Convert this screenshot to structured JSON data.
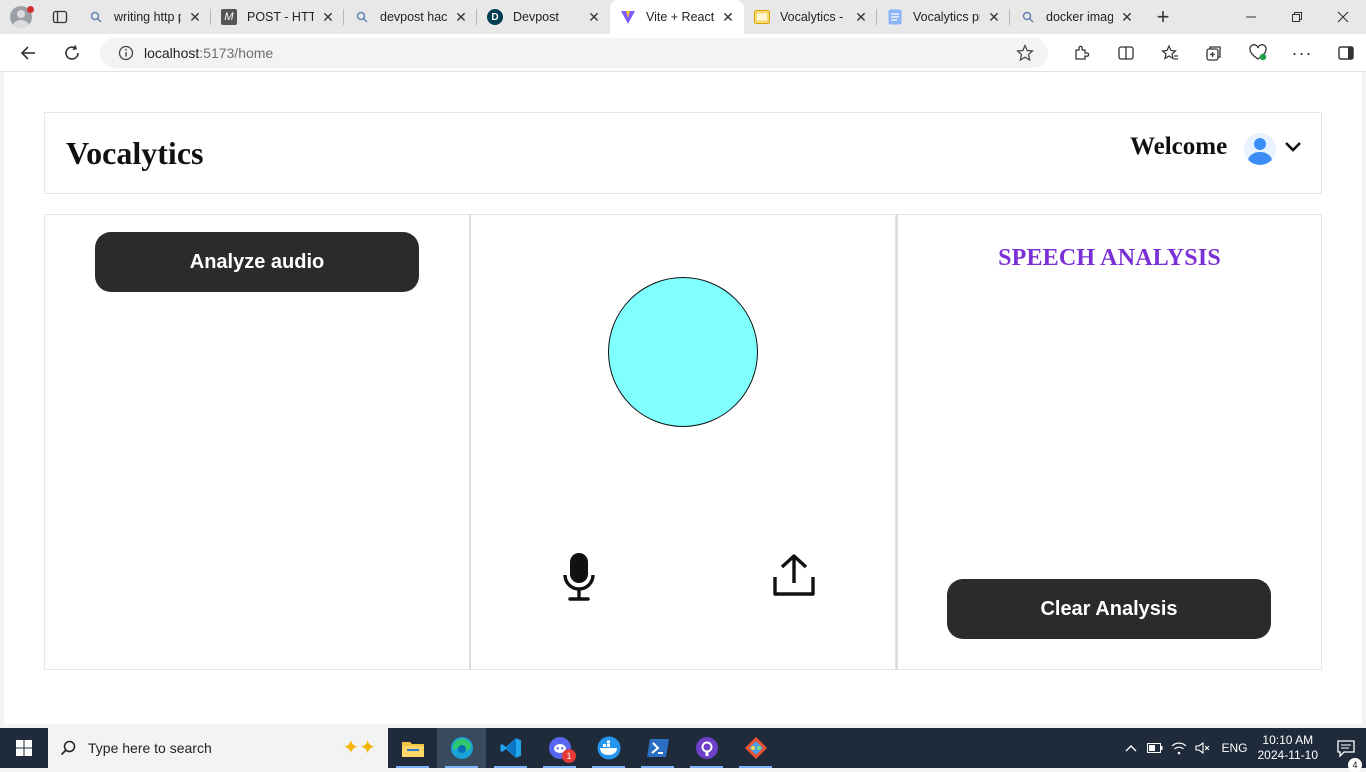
{
  "browser": {
    "tabs": [
      {
        "title": "writing http p",
        "icon": "search-icon"
      },
      {
        "title": "POST - HTTP",
        "icon": "mdn-icon"
      },
      {
        "title": "devpost hack",
        "icon": "search-icon"
      },
      {
        "title": "Devpost",
        "icon": "devpost-icon"
      },
      {
        "title": "Vite + React",
        "icon": "vite-icon",
        "active": true
      },
      {
        "title": "Vocalytics - H",
        "icon": "slides-icon"
      },
      {
        "title": "Vocalytics pre",
        "icon": "docs-icon"
      },
      {
        "title": "docker image",
        "icon": "search-icon"
      }
    ],
    "address": {
      "host": "localhost",
      "path": ":5173/home"
    }
  },
  "app": {
    "brand": "Vocalytics",
    "welcome": "Welcome",
    "analyze_label": "Analyze audio",
    "speech_title": "SPEECH ANALYSIS",
    "clear_label": "Clear Analysis",
    "orb_color": "#80ffff",
    "title_color": "#7b2fd6"
  },
  "taskbar": {
    "search_placeholder": "Type here to search",
    "language": "ENG",
    "time": "10:10 AM",
    "date": "2024-11-10",
    "notification_count": "4",
    "discord_badge": "1"
  }
}
